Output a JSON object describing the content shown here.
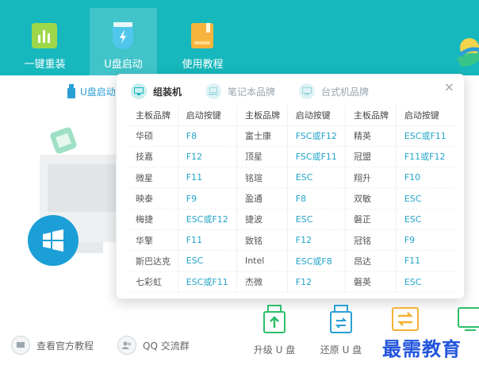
{
  "nav": {
    "items": [
      {
        "label": "一键重装",
        "icon": "bar-chart-icon"
      },
      {
        "label": "U盘启动",
        "icon": "usb-shield-icon"
      },
      {
        "label": "使用教程",
        "icon": "book-icon"
      }
    ]
  },
  "subbar": {
    "usb_tab_label": "U盘启动"
  },
  "popup": {
    "tabs": [
      {
        "label": "组装机",
        "active": true
      },
      {
        "label": "笔记本品牌",
        "active": false
      },
      {
        "label": "台式机品牌",
        "active": false
      }
    ],
    "close_label": "×",
    "headers": [
      "主板品牌",
      "启动按键",
      "主板品牌",
      "启动按键",
      "主板品牌",
      "启动按键"
    ],
    "rows": [
      [
        "华硕",
        "F8",
        "富士康",
        "FSC或F12",
        "精英",
        "ESC或F11"
      ],
      [
        "技嘉",
        "F12",
        "顶星",
        "FSC或F11",
        "冠盟",
        "F11或F12"
      ],
      [
        "微星",
        "F11",
        "铭瑄",
        "ESC",
        "翔升",
        "F10"
      ],
      [
        "映泰",
        "F9",
        "盈通",
        "F8",
        "双敏",
        "ESC"
      ],
      [
        "梅捷",
        "ESC或F12",
        "捷波",
        "ESC",
        "磐正",
        "ESC"
      ],
      [
        "华擎",
        "F11",
        "致铭",
        "F12",
        "冠铭",
        "F9"
      ],
      [
        "斯巴达克",
        "ESC",
        "Intel",
        "ESC或F8",
        "昂达",
        "F11"
      ],
      [
        "七彩虹",
        "ESC或F11",
        "杰微",
        "F12",
        "磐英",
        "ESC"
      ]
    ]
  },
  "bottom": {
    "links": [
      {
        "label": "查看官方教程",
        "icon": "book-circle-icon"
      },
      {
        "label": "QQ 交流群",
        "icon": "qq-group-icon"
      }
    ],
    "tools": [
      {
        "label": "升级 U 盘",
        "icon": "usb-upgrade-icon"
      },
      {
        "label": "还原 U 盘",
        "icon": "usb-restore-icon"
      }
    ],
    "watermark": "最需教育"
  },
  "colors": {
    "header": "#16b8bd",
    "accent_blue": "#23a5c9",
    "watermark": "#2255dd"
  }
}
